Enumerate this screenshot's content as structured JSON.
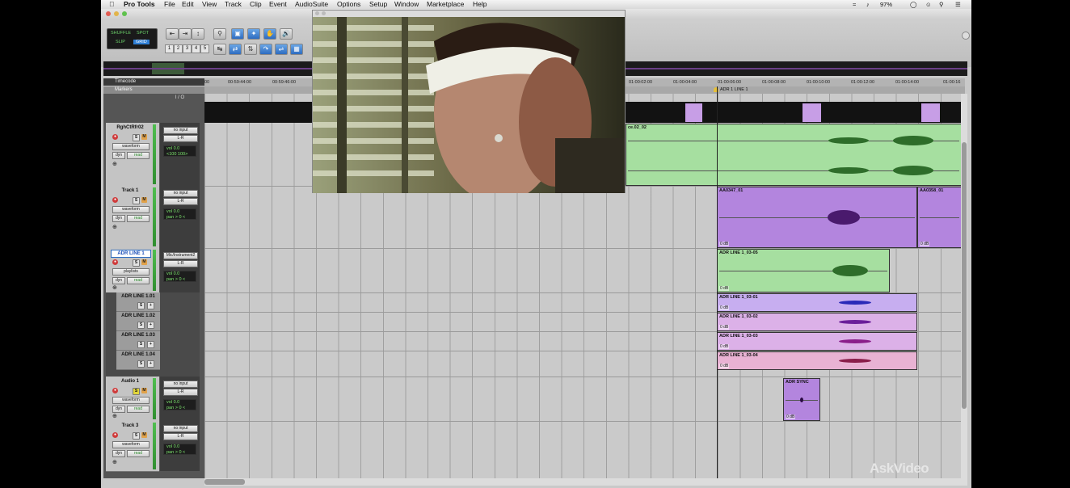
{
  "menubar": {
    "app": "Pro Tools",
    "items": [
      "File",
      "Edit",
      "View",
      "Track",
      "Clip",
      "Event",
      "AudioSuite",
      "Options",
      "Setup",
      "Window",
      "Marketplace",
      "Help"
    ],
    "battery": "97%"
  },
  "toolbar": {
    "modes": [
      "SHUFFLE",
      "SPOT",
      "SLIP",
      "GRID"
    ],
    "zoom_presets": [
      "1",
      "2",
      "3",
      "4",
      "5"
    ]
  },
  "rulers": {
    "timecode_label": "Timecode",
    "markers_label": "Markers",
    "io_label": "I / O",
    "ticks": [
      "00",
      "00:59:44:00",
      "00:59:46:00",
      "01:00:02:00",
      "01:00:04:00",
      "01:00:06:00",
      "01:00:08:00",
      "01:00:10:00",
      "01:00:12:00",
      "01:00:14:00",
      "01:00:16"
    ],
    "marker_name": "ADR 1 LINE 1"
  },
  "tracks": [
    {
      "name": "RghCtRfr02",
      "io_in": "no input",
      "io_out": "L-R",
      "view": "waveform",
      "auto": "read",
      "vol": "0.0",
      "pan": "<100  100>",
      "pan_label": "vol"
    },
    {
      "name": "Track 1",
      "io_in": "no input",
      "io_out": "L-R",
      "view": "waveform",
      "auto": "read",
      "vol": "0.0",
      "pan": "> 0 <"
    },
    {
      "name": "ADR LINE 1",
      "io_in": "Mic/Instrument2",
      "io_out": "L-R",
      "view": "playlists",
      "auto": "read",
      "vol": "0.0",
      "pan": "> 0 <"
    },
    {
      "name": "Audio 1",
      "io_in": "no input",
      "io_out": "L-R",
      "view": "waveform",
      "auto": "read",
      "vol": "0.0",
      "pan": "> 0 <"
    },
    {
      "name": "Track 3",
      "io_in": "no input",
      "io_out": "L-R",
      "view": "waveform",
      "auto": "read",
      "vol": "0.0",
      "pan": "> 0 <"
    }
  ],
  "labels": {
    "dyn": "dyn",
    "vol": "vol",
    "pan": "pan",
    "solo": "S",
    "mute": "M",
    "plus": "+"
  },
  "playlists": [
    "ADR LINE 1.01",
    "ADR LINE 1.02",
    "ADR LINE 1.03",
    "ADR LINE 1.04"
  ],
  "clips": {
    "c1": "ce.02_02",
    "c2": "AA0347_01",
    "c3": "AA0358_01",
    "c4": "ADR LINE 1_03-05",
    "c5": "ADR LINE 1_03-01",
    "c6": "ADR LINE 1_03-02",
    "c7": "ADR LINE 1_03-03",
    "c8": "ADR LINE 1_03-04",
    "c9": "ADR SYNC",
    "gain": "0 dB"
  },
  "watermark": "AskVideo",
  "colors": {
    "clip_green": "#a6dfa0",
    "clip_purple": "#b385de",
    "clip_lilac": "#c7aef0",
    "clip_pink": "#e9b2d3",
    "mode_grid": "#2f7fd6"
  }
}
